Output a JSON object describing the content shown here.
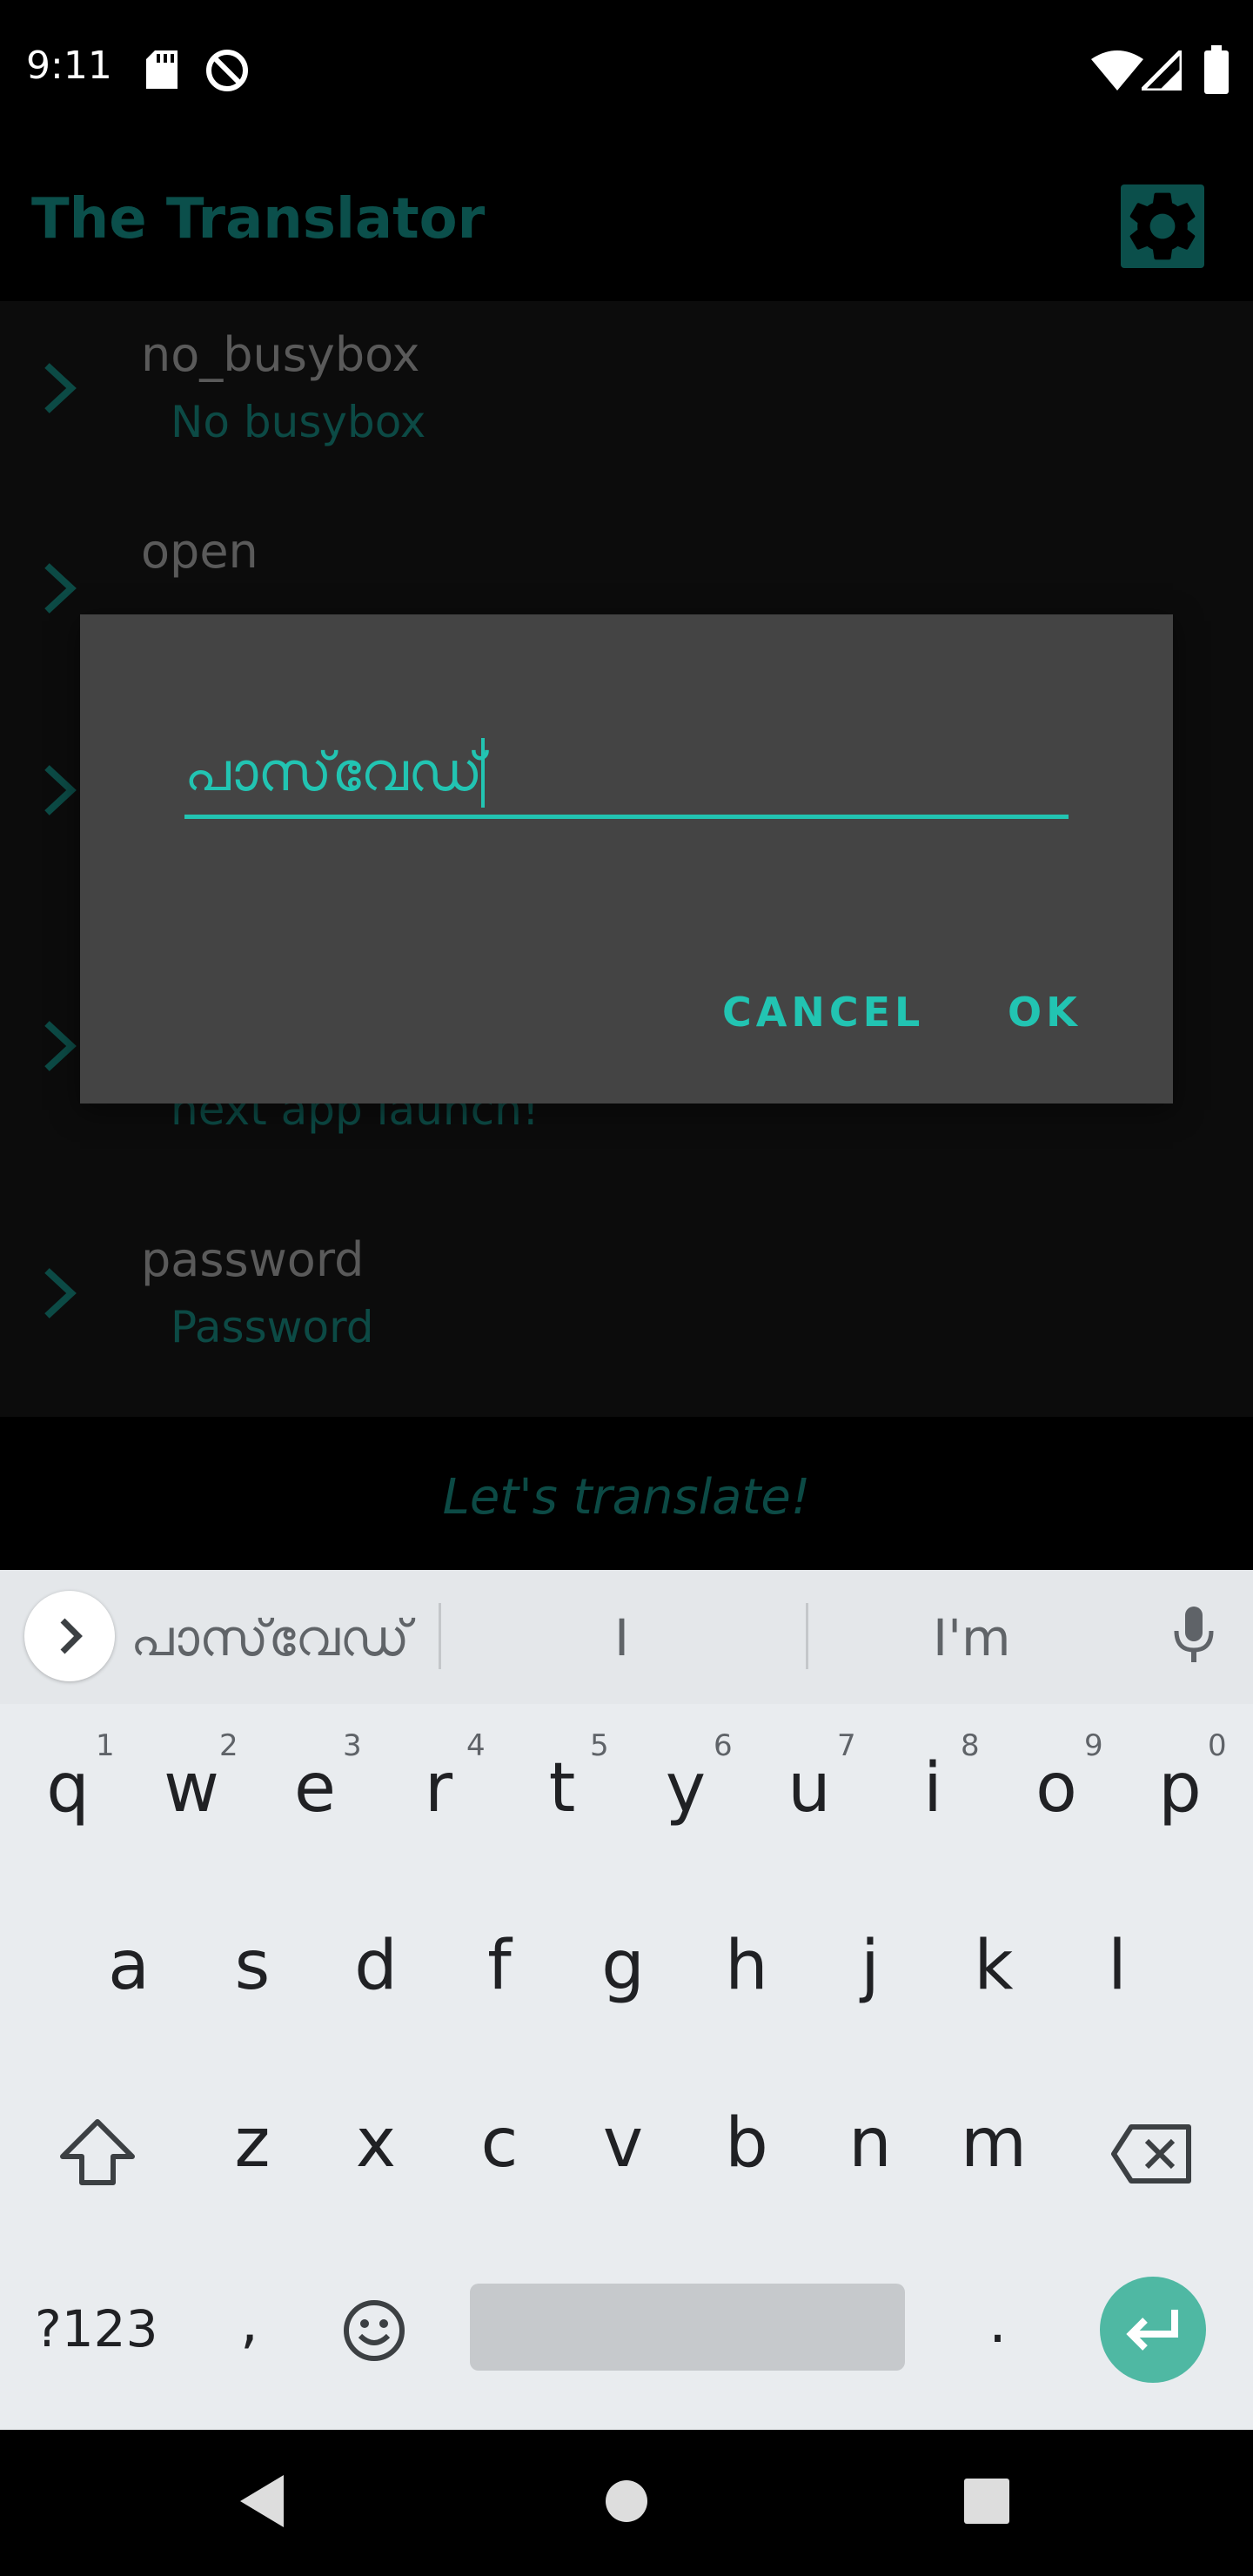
{
  "status_bar": {
    "time": "9:11",
    "left_icons": [
      "sd-card-icon",
      "do-not-disturb-icon"
    ],
    "right_icons": [
      "wifi-icon",
      "signal-icon",
      "battery-icon"
    ]
  },
  "app_bar": {
    "title": "The Translator",
    "settings_icon": "gear-icon"
  },
  "list": {
    "items": [
      {
        "title": "no_busybox",
        "subtitle": "No busybox"
      },
      {
        "title": "open",
        "subtitle": ""
      },
      {
        "title": "",
        "subtitle": ""
      },
      {
        "title": "",
        "subtitle": "next app launch!"
      },
      {
        "title": "password",
        "subtitle": "Password"
      }
    ]
  },
  "footer": {
    "text": "Let's translate!"
  },
  "dialog": {
    "input_value": "പാസ്‌വേഡ്",
    "cancel_label": "CANCEL",
    "ok_label": "OK"
  },
  "keyboard": {
    "suggestions": [
      "പാസ്‌വേഡ്",
      "I",
      "I'm"
    ],
    "row1": [
      "q",
      "w",
      "e",
      "r",
      "t",
      "y",
      "u",
      "i",
      "o",
      "p"
    ],
    "row1_hints": [
      "1",
      "2",
      "3",
      "4",
      "5",
      "6",
      "7",
      "8",
      "9",
      "0"
    ],
    "row2": [
      "a",
      "s",
      "d",
      "f",
      "g",
      "h",
      "j",
      "k",
      "l"
    ],
    "row3": [
      "z",
      "x",
      "c",
      "v",
      "b",
      "n",
      "m"
    ],
    "symbols_label": "?123",
    "comma_label": ",",
    "period_label": "."
  },
  "colors": {
    "accent": "#22c4b2",
    "app_teal": "#0b4f4b",
    "dialog_bg": "#444444",
    "keyboard_bg": "#e9ecef",
    "enter_key": "#4fb8a3"
  }
}
